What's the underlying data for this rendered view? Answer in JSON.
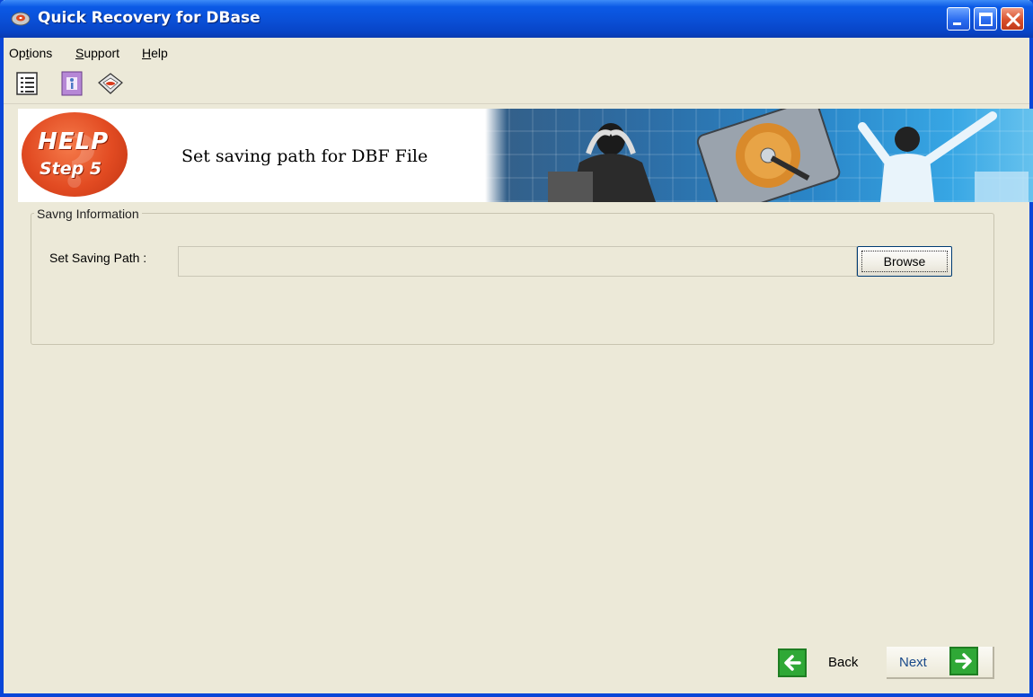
{
  "window": {
    "title": "Quick Recovery for DBase",
    "title_color": "#ffffff",
    "accent": "#0a4fd6"
  },
  "menu": {
    "items": [
      {
        "label": "Options",
        "mnemonic": "t"
      },
      {
        "label": "Support",
        "mnemonic": "S"
      },
      {
        "label": "Help",
        "mnemonic": "H"
      }
    ]
  },
  "toolbar": {
    "icons": [
      "list-icon",
      "file-info-icon",
      "disk-recovery-icon"
    ]
  },
  "banner": {
    "help_word": "HELP",
    "step_word": "Step 5",
    "title": "Set saving path for DBF File"
  },
  "saving": {
    "group_title": "Savng Information",
    "path_label": "Set Saving Path  :",
    "path_value": "",
    "browse_label": "Browse"
  },
  "nav": {
    "back_label": "Back",
    "next_label": "Next",
    "arrow_color": "#2fa836"
  }
}
